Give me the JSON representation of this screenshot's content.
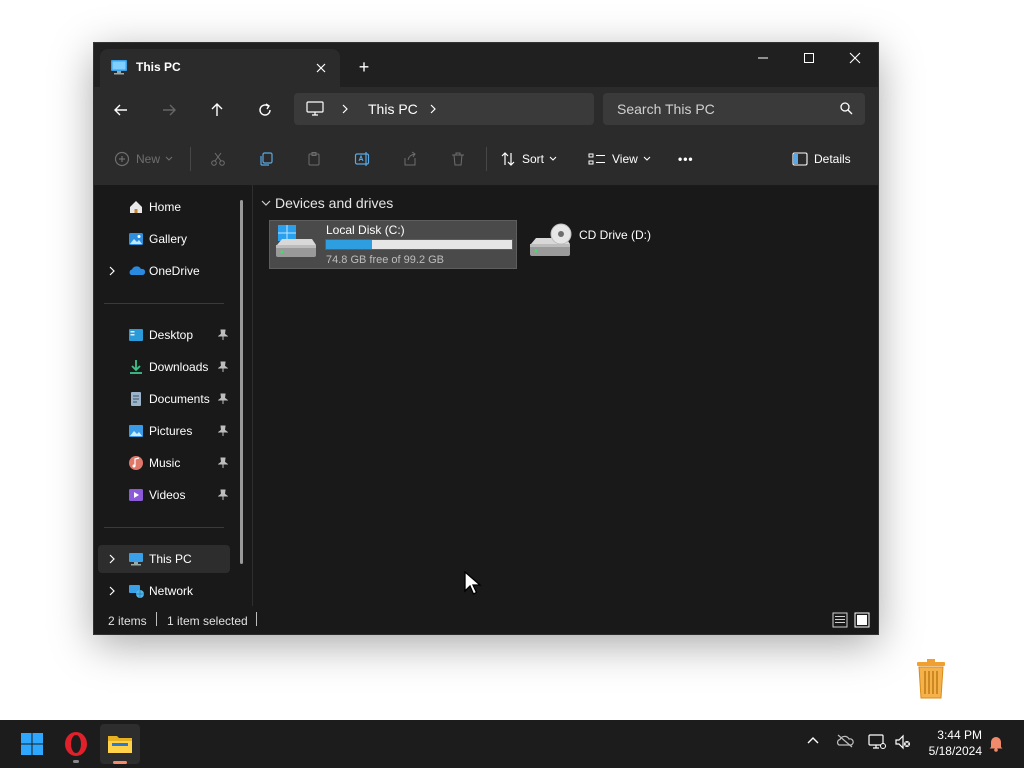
{
  "window": {
    "tab_title": "This PC",
    "new_tab": "+"
  },
  "address": {
    "crumb": "This PC",
    "search_placeholder": "Search This PC"
  },
  "toolbar": {
    "new_label": "New",
    "sort_label": "Sort",
    "view_label": "View",
    "more_label": "•••",
    "details_label": "Details"
  },
  "sidebar": {
    "items": [
      {
        "label": "Home",
        "icon": "home-icon"
      },
      {
        "label": "Gallery",
        "icon": "gallery-icon"
      },
      {
        "label": "OneDrive",
        "icon": "onedrive-icon"
      },
      {
        "label": "Desktop",
        "icon": "desktop-icon"
      },
      {
        "label": "Downloads",
        "icon": "downloads-icon"
      },
      {
        "label": "Documents",
        "icon": "documents-icon"
      },
      {
        "label": "Pictures",
        "icon": "pictures-icon"
      },
      {
        "label": "Music",
        "icon": "music-icon"
      },
      {
        "label": "Videos",
        "icon": "videos-icon"
      },
      {
        "label": "This PC",
        "icon": "this-pc-icon"
      },
      {
        "label": "Network",
        "icon": "network-icon"
      }
    ]
  },
  "content": {
    "group_title": "Devices and drives",
    "drives": [
      {
        "name": "Local Disk (C:)",
        "free_text": "74.8 GB free of 99.2 GB",
        "used_fraction": 0.246
      },
      {
        "name": "CD Drive (D:)"
      }
    ]
  },
  "status": {
    "items_count": "2 items",
    "selection": "1 item selected"
  },
  "clock": {
    "time": "3:44 PM",
    "date": "5/18/2024"
  },
  "colors": {
    "accent": "#2e9ee0",
    "window_bg": "#191919",
    "toolbar_bg": "#2b2b2b",
    "taskbar_bg": "#1c1c1c"
  }
}
